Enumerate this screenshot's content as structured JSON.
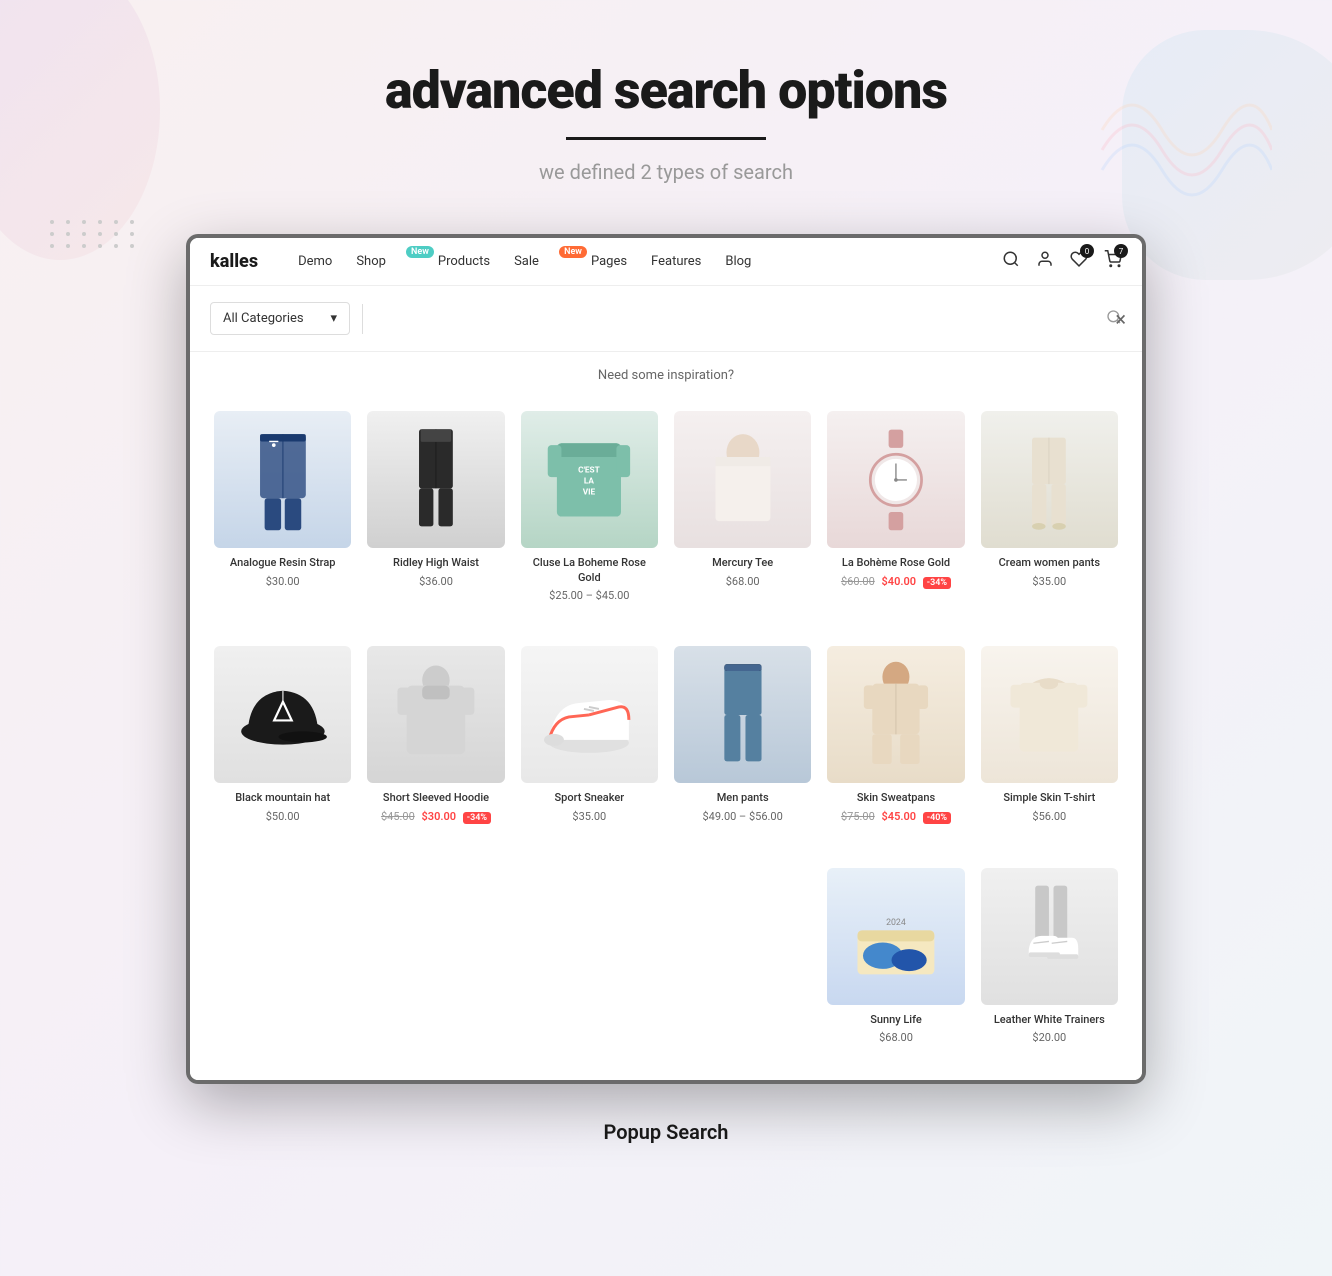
{
  "page": {
    "title": "advanced search  options",
    "underline": true,
    "subtitle": "we defined 2 types of search",
    "popup_label": "Popup Search"
  },
  "navbar": {
    "logo": "kalles",
    "nav_items": [
      {
        "label": "Demo",
        "badge": null
      },
      {
        "label": "Shop",
        "badge": {
          "text": "New",
          "color": "teal"
        }
      },
      {
        "label": "Products",
        "badge": null
      },
      {
        "label": "Sale",
        "badge": {
          "text": "New",
          "color": "orange"
        }
      },
      {
        "label": "Pages",
        "badge": null
      },
      {
        "label": "Features",
        "badge": null
      },
      {
        "label": "Blog",
        "badge": null
      }
    ],
    "icons": {
      "search": "🔍",
      "user": "👤",
      "wishlist": "♡",
      "cart": "🛒",
      "cart_badge": "7",
      "wishlist_badge": "0"
    }
  },
  "search_modal": {
    "close_label": "×",
    "category_placeholder": "All Categories",
    "search_placeholder": "",
    "inspiration_text": "Need some inspiration?",
    "search_icon": "🔍"
  },
  "products_row1": [
    {
      "id": 1,
      "name": "Analogue Resin Strap",
      "price": "$30.00",
      "original_price": null,
      "sale_price": null,
      "badge": null,
      "theme": "prod-1"
    },
    {
      "id": 2,
      "name": "Ridley High Waist",
      "price": "$36.00",
      "original_price": null,
      "sale_price": null,
      "badge": null,
      "theme": "prod-2"
    },
    {
      "id": 3,
      "name": "Cluse La Boheme Rose Gold",
      "price_range": "$25.00 – $45.00",
      "original_price": null,
      "sale_price": null,
      "badge": null,
      "theme": "prod-3"
    },
    {
      "id": 4,
      "name": "Mercury Tee",
      "price": "$68.00",
      "original_price": null,
      "sale_price": null,
      "badge": null,
      "theme": "prod-4"
    },
    {
      "id": 5,
      "name": "La Bohème Rose Gold",
      "price": "$40.00",
      "original_price": "$60.00",
      "sale_price": "$40.00",
      "badge": "-34%",
      "theme": "prod-5"
    },
    {
      "id": 6,
      "name": "Cream women pants",
      "price": "$35.00",
      "original_price": null,
      "sale_price": null,
      "badge": null,
      "theme": "prod-6"
    }
  ],
  "products_row2": [
    {
      "id": 7,
      "name": "Black mountain hat",
      "price": "$50.00",
      "original_price": null,
      "sale_price": null,
      "badge": null,
      "theme": "prod-1"
    },
    {
      "id": 8,
      "name": "Short Sleeved Hoodie",
      "price": "$30.00",
      "original_price": "$45.00",
      "sale_price": "$30.00",
      "badge": "-34%",
      "theme": "prod-7"
    },
    {
      "id": 9,
      "name": "Sport Sneaker",
      "price": "$35.00",
      "original_price": null,
      "sale_price": null,
      "badge": null,
      "theme": "prod-8"
    },
    {
      "id": 10,
      "name": "Men pants",
      "price_range": "$49.00 – $56.00",
      "original_price": null,
      "sale_price": null,
      "badge": null,
      "theme": "prod-9"
    },
    {
      "id": 11,
      "name": "Skin Sweatpans",
      "price": "$45.00",
      "original_price": "$75.00",
      "sale_price": "$45.00",
      "badge": "-40%",
      "theme": "prod-10"
    },
    {
      "id": 12,
      "name": "Simple Skin T-shirt",
      "price": "$56.00",
      "original_price": null,
      "sale_price": null,
      "badge": null,
      "theme": "prod-11"
    }
  ],
  "products_row3": [
    {
      "id": 13,
      "name": "Sunny Life",
      "price": "$68.00",
      "original_price": null,
      "sale_price": null,
      "badge": null,
      "theme": "prod-8"
    },
    {
      "id": 14,
      "name": "Leather White Trainers",
      "price": "$20.00",
      "original_price": null,
      "sale_price": null,
      "badge": null,
      "theme": "prod-12"
    }
  ]
}
